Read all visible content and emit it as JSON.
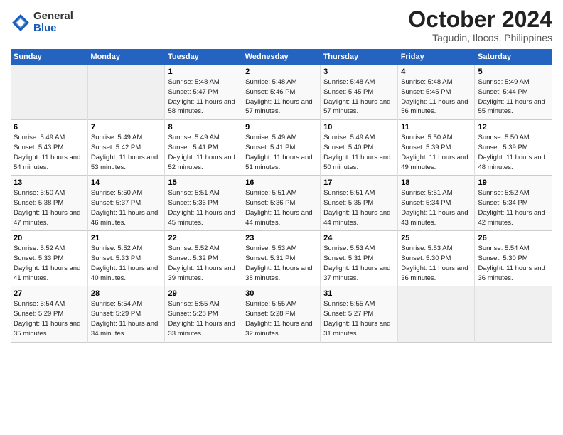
{
  "header": {
    "logo_general": "General",
    "logo_blue": "Blue",
    "month": "October 2024",
    "location": "Tagudin, Ilocos, Philippines"
  },
  "columns": [
    "Sunday",
    "Monday",
    "Tuesday",
    "Wednesday",
    "Thursday",
    "Friday",
    "Saturday"
  ],
  "weeks": [
    [
      {
        "day": "",
        "info": ""
      },
      {
        "day": "",
        "info": ""
      },
      {
        "day": "1",
        "info": "Sunrise: 5:48 AM\nSunset: 5:47 PM\nDaylight: 11 hours and 58 minutes."
      },
      {
        "day": "2",
        "info": "Sunrise: 5:48 AM\nSunset: 5:46 PM\nDaylight: 11 hours and 57 minutes."
      },
      {
        "day": "3",
        "info": "Sunrise: 5:48 AM\nSunset: 5:45 PM\nDaylight: 11 hours and 57 minutes."
      },
      {
        "day": "4",
        "info": "Sunrise: 5:48 AM\nSunset: 5:45 PM\nDaylight: 11 hours and 56 minutes."
      },
      {
        "day": "5",
        "info": "Sunrise: 5:49 AM\nSunset: 5:44 PM\nDaylight: 11 hours and 55 minutes."
      }
    ],
    [
      {
        "day": "6",
        "info": "Sunrise: 5:49 AM\nSunset: 5:43 PM\nDaylight: 11 hours and 54 minutes."
      },
      {
        "day": "7",
        "info": "Sunrise: 5:49 AM\nSunset: 5:42 PM\nDaylight: 11 hours and 53 minutes."
      },
      {
        "day": "8",
        "info": "Sunrise: 5:49 AM\nSunset: 5:41 PM\nDaylight: 11 hours and 52 minutes."
      },
      {
        "day": "9",
        "info": "Sunrise: 5:49 AM\nSunset: 5:41 PM\nDaylight: 11 hours and 51 minutes."
      },
      {
        "day": "10",
        "info": "Sunrise: 5:49 AM\nSunset: 5:40 PM\nDaylight: 11 hours and 50 minutes."
      },
      {
        "day": "11",
        "info": "Sunrise: 5:50 AM\nSunset: 5:39 PM\nDaylight: 11 hours and 49 minutes."
      },
      {
        "day": "12",
        "info": "Sunrise: 5:50 AM\nSunset: 5:39 PM\nDaylight: 11 hours and 48 minutes."
      }
    ],
    [
      {
        "day": "13",
        "info": "Sunrise: 5:50 AM\nSunset: 5:38 PM\nDaylight: 11 hours and 47 minutes."
      },
      {
        "day": "14",
        "info": "Sunrise: 5:50 AM\nSunset: 5:37 PM\nDaylight: 11 hours and 46 minutes."
      },
      {
        "day": "15",
        "info": "Sunrise: 5:51 AM\nSunset: 5:36 PM\nDaylight: 11 hours and 45 minutes."
      },
      {
        "day": "16",
        "info": "Sunrise: 5:51 AM\nSunset: 5:36 PM\nDaylight: 11 hours and 44 minutes."
      },
      {
        "day": "17",
        "info": "Sunrise: 5:51 AM\nSunset: 5:35 PM\nDaylight: 11 hours and 44 minutes."
      },
      {
        "day": "18",
        "info": "Sunrise: 5:51 AM\nSunset: 5:34 PM\nDaylight: 11 hours and 43 minutes."
      },
      {
        "day": "19",
        "info": "Sunrise: 5:52 AM\nSunset: 5:34 PM\nDaylight: 11 hours and 42 minutes."
      }
    ],
    [
      {
        "day": "20",
        "info": "Sunrise: 5:52 AM\nSunset: 5:33 PM\nDaylight: 11 hours and 41 minutes."
      },
      {
        "day": "21",
        "info": "Sunrise: 5:52 AM\nSunset: 5:33 PM\nDaylight: 11 hours and 40 minutes."
      },
      {
        "day": "22",
        "info": "Sunrise: 5:52 AM\nSunset: 5:32 PM\nDaylight: 11 hours and 39 minutes."
      },
      {
        "day": "23",
        "info": "Sunrise: 5:53 AM\nSunset: 5:31 PM\nDaylight: 11 hours and 38 minutes."
      },
      {
        "day": "24",
        "info": "Sunrise: 5:53 AM\nSunset: 5:31 PM\nDaylight: 11 hours and 37 minutes."
      },
      {
        "day": "25",
        "info": "Sunrise: 5:53 AM\nSunset: 5:30 PM\nDaylight: 11 hours and 36 minutes."
      },
      {
        "day": "26",
        "info": "Sunrise: 5:54 AM\nSunset: 5:30 PM\nDaylight: 11 hours and 36 minutes."
      }
    ],
    [
      {
        "day": "27",
        "info": "Sunrise: 5:54 AM\nSunset: 5:29 PM\nDaylight: 11 hours and 35 minutes."
      },
      {
        "day": "28",
        "info": "Sunrise: 5:54 AM\nSunset: 5:29 PM\nDaylight: 11 hours and 34 minutes."
      },
      {
        "day": "29",
        "info": "Sunrise: 5:55 AM\nSunset: 5:28 PM\nDaylight: 11 hours and 33 minutes."
      },
      {
        "day": "30",
        "info": "Sunrise: 5:55 AM\nSunset: 5:28 PM\nDaylight: 11 hours and 32 minutes."
      },
      {
        "day": "31",
        "info": "Sunrise: 5:55 AM\nSunset: 5:27 PM\nDaylight: 11 hours and 31 minutes."
      },
      {
        "day": "",
        "info": ""
      },
      {
        "day": "",
        "info": ""
      }
    ]
  ]
}
